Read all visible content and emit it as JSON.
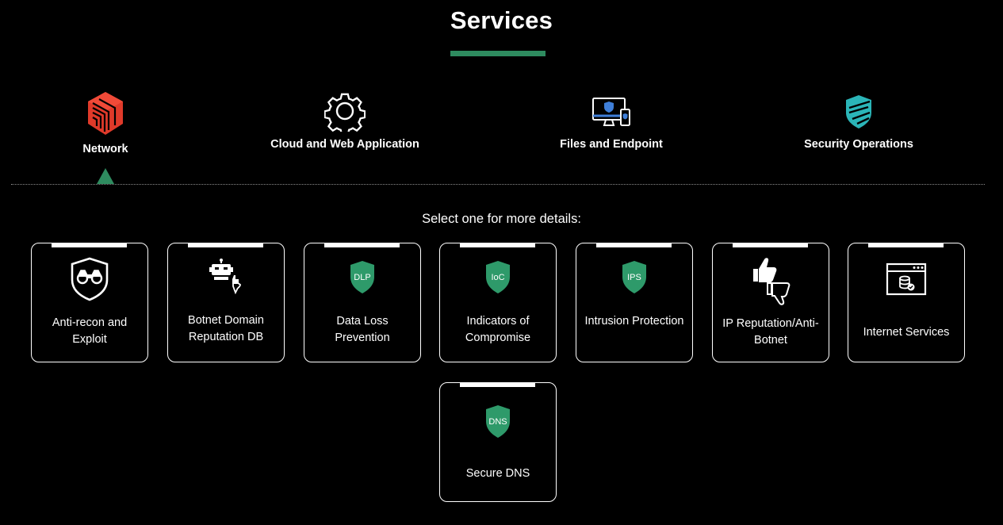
{
  "page": {
    "title": "Services",
    "accent": "#2e8b5f"
  },
  "tabs": [
    {
      "label": "Network",
      "icon": "network-cube-icon",
      "active": true
    },
    {
      "label": "Cloud and Web Application",
      "icon": "gear-icon"
    },
    {
      "label": "Files and Endpoint",
      "icon": "devices-shield-icon"
    },
    {
      "label": "Security Operations",
      "icon": "secops-shield-icon"
    }
  ],
  "subtitle": "Select one for more details:",
  "cards": [
    {
      "label": "Anti-recon and Exploit",
      "icon": "binoculars-shield-icon"
    },
    {
      "label": "Botnet Domain Reputation DB",
      "icon": "robot-thumbs-icon"
    },
    {
      "label": "Data Loss Prevention",
      "icon": "dlp-shield-icon",
      "badge": "DLP"
    },
    {
      "label": "Indicators of Compromise",
      "icon": "ioc-shield-icon",
      "badge": "IoC"
    },
    {
      "label": "Intrusion Protection",
      "icon": "ips-shield-icon",
      "badge": "IPS"
    },
    {
      "label": "IP Reputation/Anti-Botnet",
      "icon": "thumbs-up-down-icon"
    },
    {
      "label": "Internet Services",
      "icon": "browser-database-icon"
    },
    {
      "label": "Secure DNS",
      "icon": "dns-shield-icon",
      "badge": "DNS"
    }
  ]
}
